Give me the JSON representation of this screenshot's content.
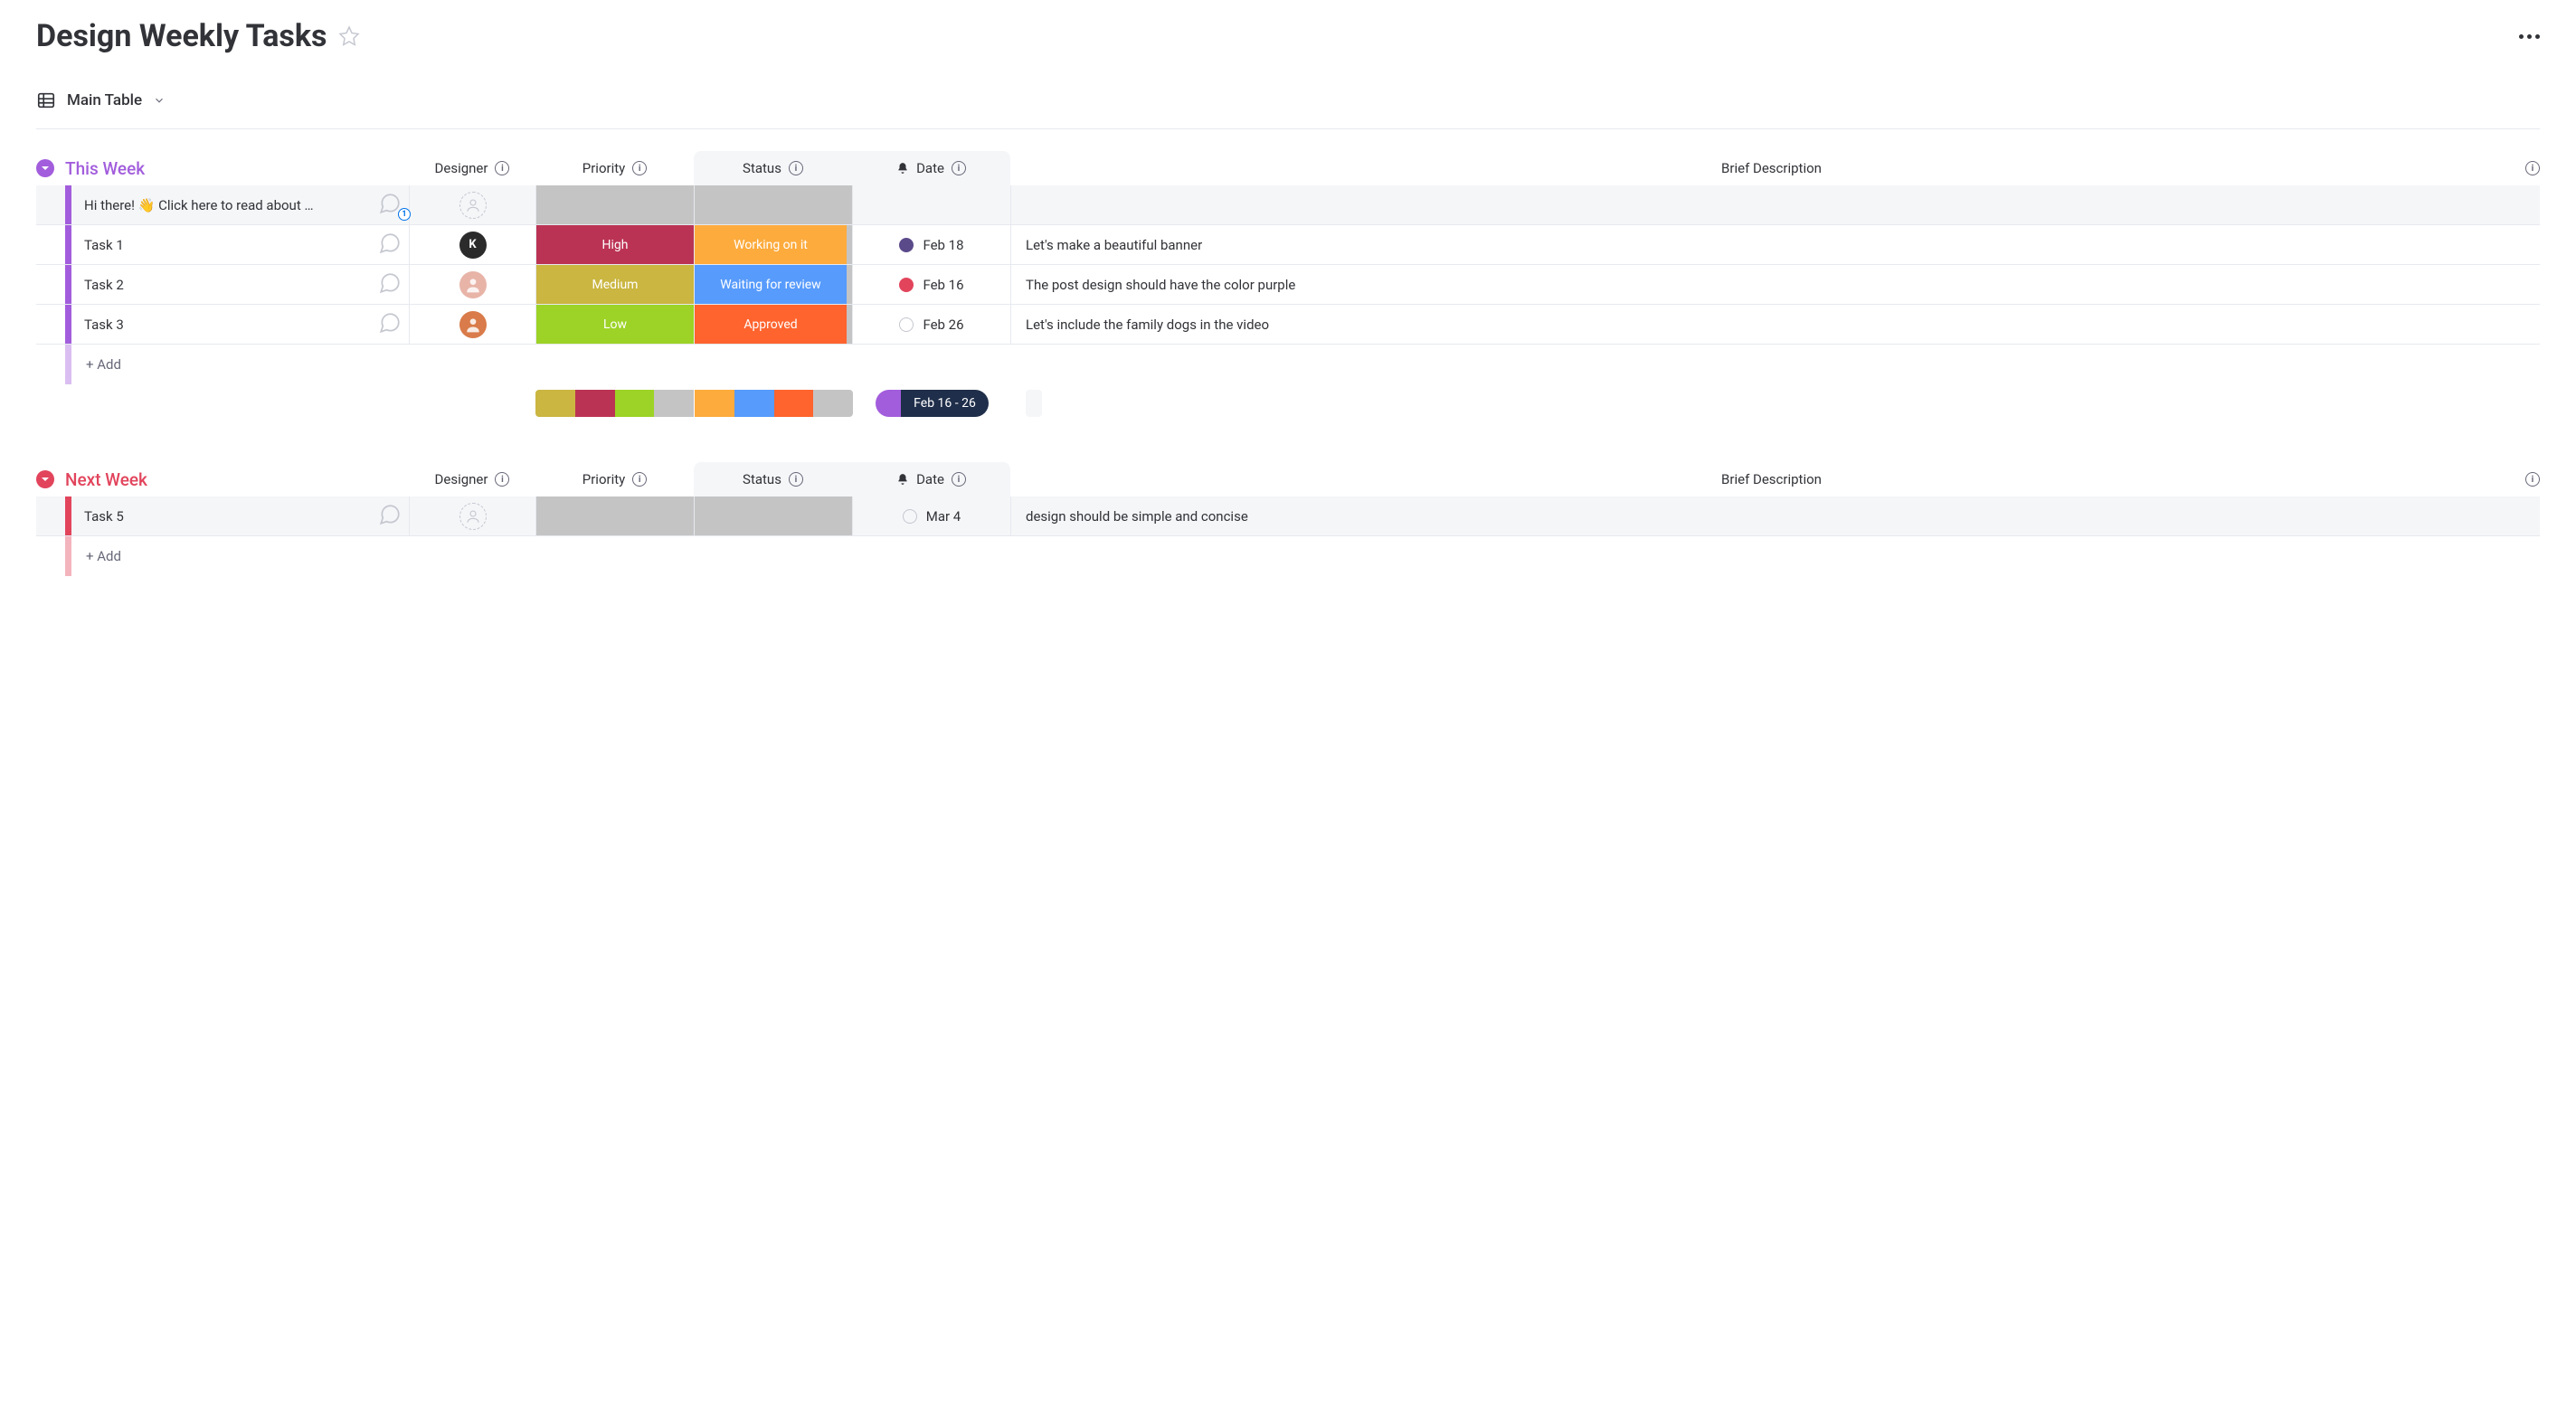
{
  "page_title": "Design Weekly Tasks",
  "view_label": "Main Table",
  "columns": {
    "designer": "Designer",
    "priority": "Priority",
    "status": "Status",
    "date": "Date",
    "description": "Brief Description"
  },
  "add_label": "+ Add",
  "groups": [
    {
      "title": "This Week",
      "color": "#a25ddc",
      "rows": [
        {
          "title": "Hi there! 👋 Click here to read about …",
          "chat_count": "1",
          "chat_highlight": true,
          "designer": {
            "type": "empty"
          },
          "priority": {
            "label": "",
            "color": "#c4c4c4"
          },
          "status": {
            "label": "",
            "color": "#c4c4c4"
          },
          "date": {
            "label": "",
            "dot": ""
          },
          "description": ""
        },
        {
          "title": "Task 1",
          "designer": {
            "type": "initial",
            "initial": "K",
            "bg": "#2b2b2b"
          },
          "priority": {
            "label": "High",
            "color": "#bb3354"
          },
          "status": {
            "label": "Working on it",
            "color": "#fdab3d"
          },
          "date": {
            "label": "Feb 18",
            "dot": "#5b4a8a"
          },
          "description": "Let's make a beautiful banner"
        },
        {
          "title": "Task 2",
          "designer": {
            "type": "photo",
            "bg": "#e8b4a8"
          },
          "priority": {
            "label": "Medium",
            "color": "#cab641"
          },
          "status": {
            "label": "Waiting for review",
            "color": "#579bfc"
          },
          "date": {
            "label": "Feb 16",
            "dot": "#e2445c"
          },
          "description": "The post design should have the color purple"
        },
        {
          "title": "Task 3",
          "designer": {
            "type": "photo",
            "bg": "#d97b4a"
          },
          "priority": {
            "label": "Low",
            "color": "#9cd326"
          },
          "status": {
            "label": "Approved",
            "color": "#ff642e"
          },
          "date": {
            "label": "Feb 26",
            "dot": "empty"
          },
          "description": "Let's include the family dogs in the video"
        }
      ],
      "summary": {
        "priority_colors": [
          "#cab641",
          "#bb3354",
          "#9cd326",
          "#c4c4c4"
        ],
        "status_colors": [
          "#fdab3d",
          "#579bfc",
          "#ff642e",
          "#c4c4c4"
        ],
        "date_range": "Feb 16 - 26",
        "date_pill_accent": "#a25ddc"
      }
    },
    {
      "title": "Next Week",
      "color": "#e2445c",
      "rows": [
        {
          "title": "Task 5",
          "designer": {
            "type": "empty"
          },
          "priority": {
            "label": "",
            "color": "#c4c4c4"
          },
          "status": {
            "label": "",
            "color": "#c4c4c4"
          },
          "date": {
            "label": "Mar 4",
            "dot": "empty"
          },
          "description": "design should be simple and concise"
        }
      ]
    }
  ]
}
